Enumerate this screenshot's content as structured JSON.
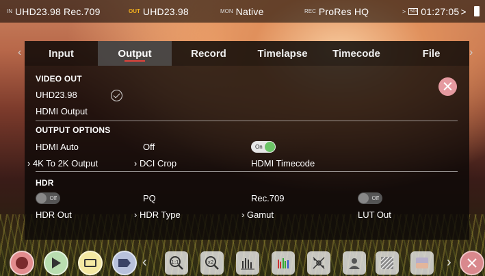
{
  "status": {
    "in_tag": "IN",
    "in_value": "UHD23.98 Rec.709",
    "out_tag": "OUT",
    "out_value": "UHD23.98",
    "mon_tag": "MON",
    "mon_value": "Native",
    "rec_tag": "REC",
    "rec_value": "ProRes HQ",
    "sdi_tag": "SDI",
    "timecode": "01:27:05"
  },
  "tabs": [
    "Input",
    "Output",
    "Record",
    "Timelapse",
    "Timecode",
    "File"
  ],
  "active_tab": "Output",
  "video_out": {
    "heading": "VIDEO OUT",
    "format": "UHD23.98",
    "source": "HDMI Output"
  },
  "output_options": {
    "heading": "OUTPUT OPTIONS",
    "hdmi_auto_label": "HDMI Auto",
    "k4_to_2k_label": "4K To 2K Output",
    "dci_crop_value": "Off",
    "dci_crop_label": "DCI Crop",
    "hdmi_timecode_toggle": "On",
    "hdmi_timecode_label": "HDMI Timecode"
  },
  "hdr": {
    "heading": "HDR",
    "hdr_out_toggle": "Off",
    "hdr_out_label": "HDR Out",
    "hdr_type_value": "PQ",
    "hdr_type_label": "HDR Type",
    "gamut_value": "Rec.709",
    "gamut_label": "Gamut",
    "lut_out_toggle": "Off",
    "lut_out_label": "LUT Out"
  },
  "colors": {
    "accent": "#e2433b",
    "out_tag": "#f2b01e",
    "toggle_on": "#6cc467",
    "close": "#e59aa0"
  }
}
